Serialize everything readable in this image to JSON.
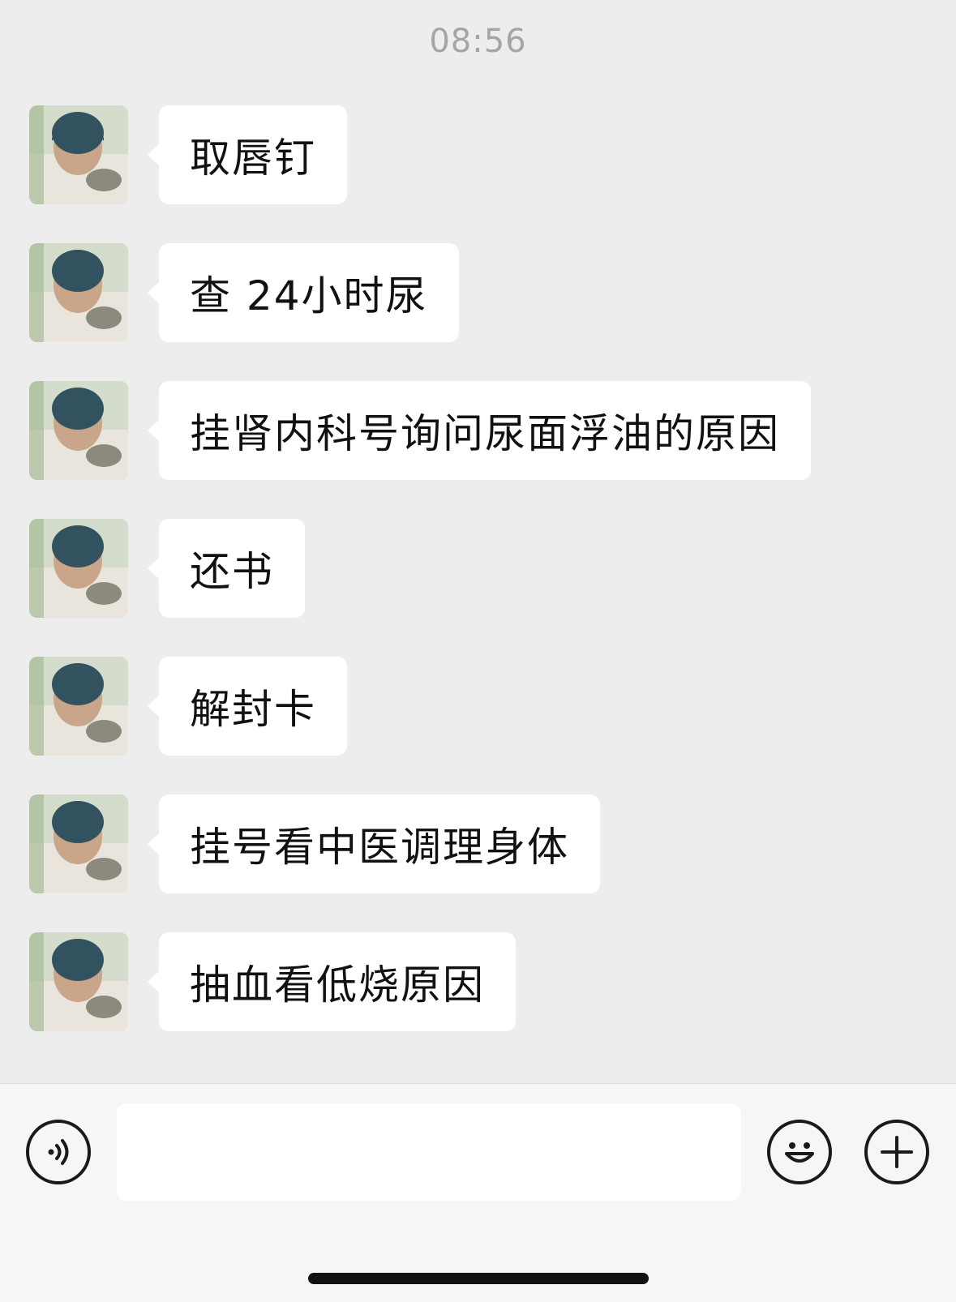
{
  "chat": {
    "timestamp": "08:56",
    "messages": [
      {
        "text": "取唇钉"
      },
      {
        "text": "查 24小时尿"
      },
      {
        "text": "挂肾内科号询问尿面浮油的原因"
      },
      {
        "text": "还书"
      },
      {
        "text": "解封卡"
      },
      {
        "text": "挂号看中医调理身体"
      },
      {
        "text": "抽血看低烧原因"
      }
    ]
  },
  "input_bar": {
    "voice_icon": "voice-icon",
    "emoji_icon": "emoji-icon",
    "plus_icon": "plus-icon",
    "text_value": ""
  },
  "colors": {
    "background": "#ededed",
    "bubble": "#ffffff",
    "timestamp": "#a5a5a5",
    "input_bar": "#f6f6f6"
  }
}
